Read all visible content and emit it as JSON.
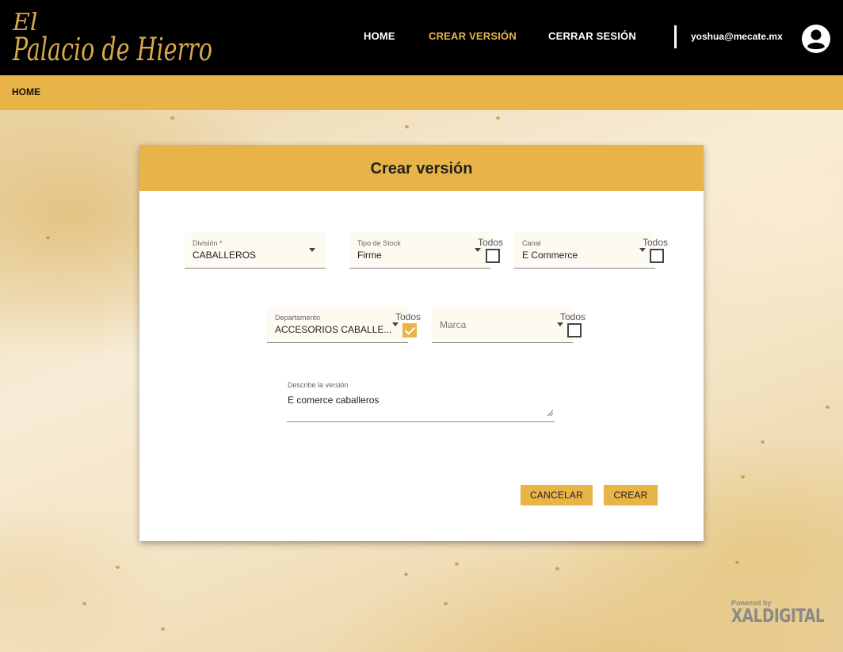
{
  "header": {
    "logo_text": "El Palacio de Hierro",
    "nav": [
      {
        "label": "HOME"
      },
      {
        "label": "CREAR VERSIÓN"
      },
      {
        "label": "CERRAR SESIÓN"
      }
    ],
    "user_email": "yoshua@mecate.mx",
    "avatar_icon": "user-circle-icon"
  },
  "breadcrumb": {
    "label": "HOME"
  },
  "dialog": {
    "title": "Crear versión",
    "fields": {
      "division": {
        "label": "División *",
        "value": "CABALLEROS"
      },
      "tipo_stock": {
        "label": "Tipo de Stock",
        "value": "Firme",
        "todos_label": "Todos",
        "todos_checked": false
      },
      "canal": {
        "label": "Canal",
        "value": "E Commerce",
        "todos_label": "Todos",
        "todos_checked": false
      },
      "departamento": {
        "label": "Departamento",
        "value": "ACCESORIOS CABALLE...",
        "todos_label": "Todos",
        "todos_checked": true
      },
      "marca": {
        "placeholder": "Marca",
        "todos_label": "Todos",
        "todos_checked": false
      },
      "descripcion": {
        "label": "Describe la versión",
        "value": "E comerce caballeros"
      }
    },
    "buttons": {
      "cancel": "CANCELAR",
      "create": "CREAR"
    }
  },
  "footer": {
    "powered_by": "Powered by",
    "brand": "XALDIGITAL"
  },
  "colors": {
    "accent": "#e8b447",
    "header_bg": "#000000"
  }
}
